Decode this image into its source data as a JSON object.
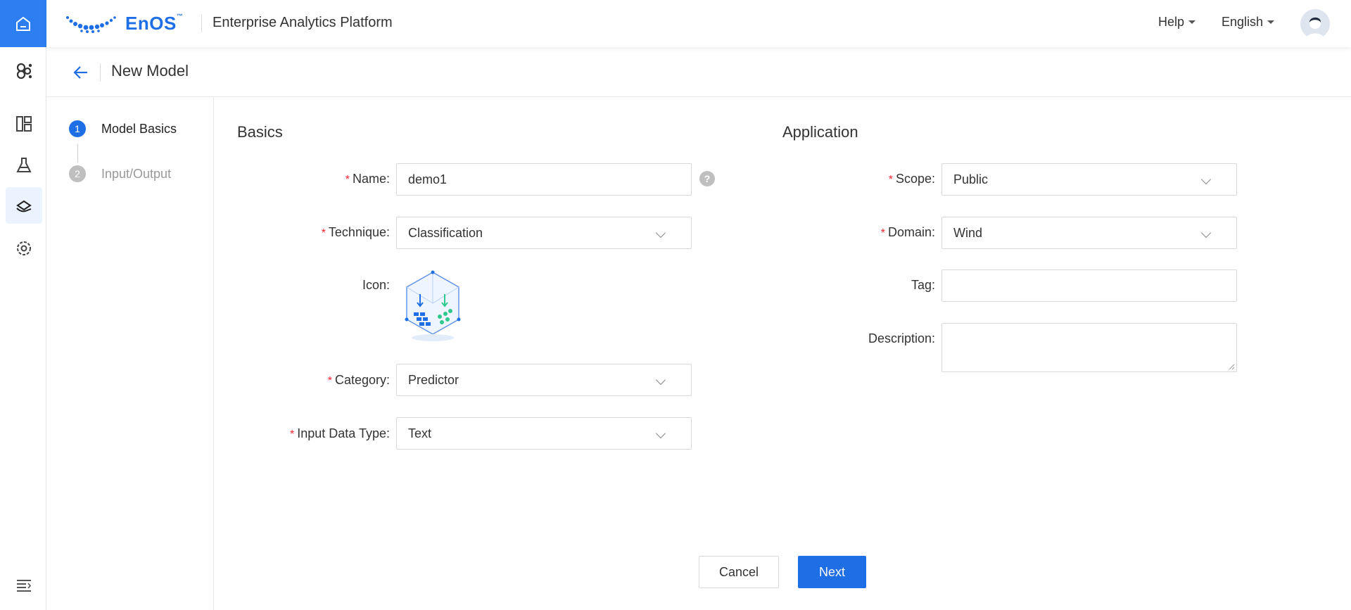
{
  "topbar": {
    "logo_text": "EnOS",
    "logo_tm": "™",
    "platform_title": "Enterprise Analytics Platform",
    "help_label": "Help",
    "language_label": "English"
  },
  "page": {
    "title": "New Model"
  },
  "steps": [
    {
      "number": "1",
      "label": "Model Basics",
      "state": "active"
    },
    {
      "number": "2",
      "label": "Input/Output",
      "state": "pending"
    }
  ],
  "basics": {
    "section_title": "Basics",
    "name_label": "Name:",
    "name_value": "demo1",
    "technique_label": "Technique:",
    "technique_value": "Classification",
    "icon_label": "Icon:",
    "category_label": "Category:",
    "category_value": "Predictor",
    "input_type_label": "Input Data Type:",
    "input_type_value": "Text",
    "help_glyph": "?"
  },
  "application": {
    "section_title": "Application",
    "scope_label": "Scope:",
    "scope_value": "Public",
    "domain_label": "Domain:",
    "domain_value": "Wind",
    "tag_label": "Tag:",
    "tag_value": "",
    "description_label": "Description:",
    "description_value": ""
  },
  "actions": {
    "cancel_label": "Cancel",
    "next_label": "Next"
  },
  "colors": {
    "primary": "#1e6fe6",
    "rail_active_bg": "#eaf3ff",
    "required": "#f5222d",
    "step_pending": "#bfbfbf"
  },
  "icons": {
    "rail": [
      "home-icon",
      "brain-icon",
      "dashboard-icon",
      "flask-icon",
      "layers-hand-icon",
      "settings-icon",
      "collapse-menu-icon"
    ]
  }
}
